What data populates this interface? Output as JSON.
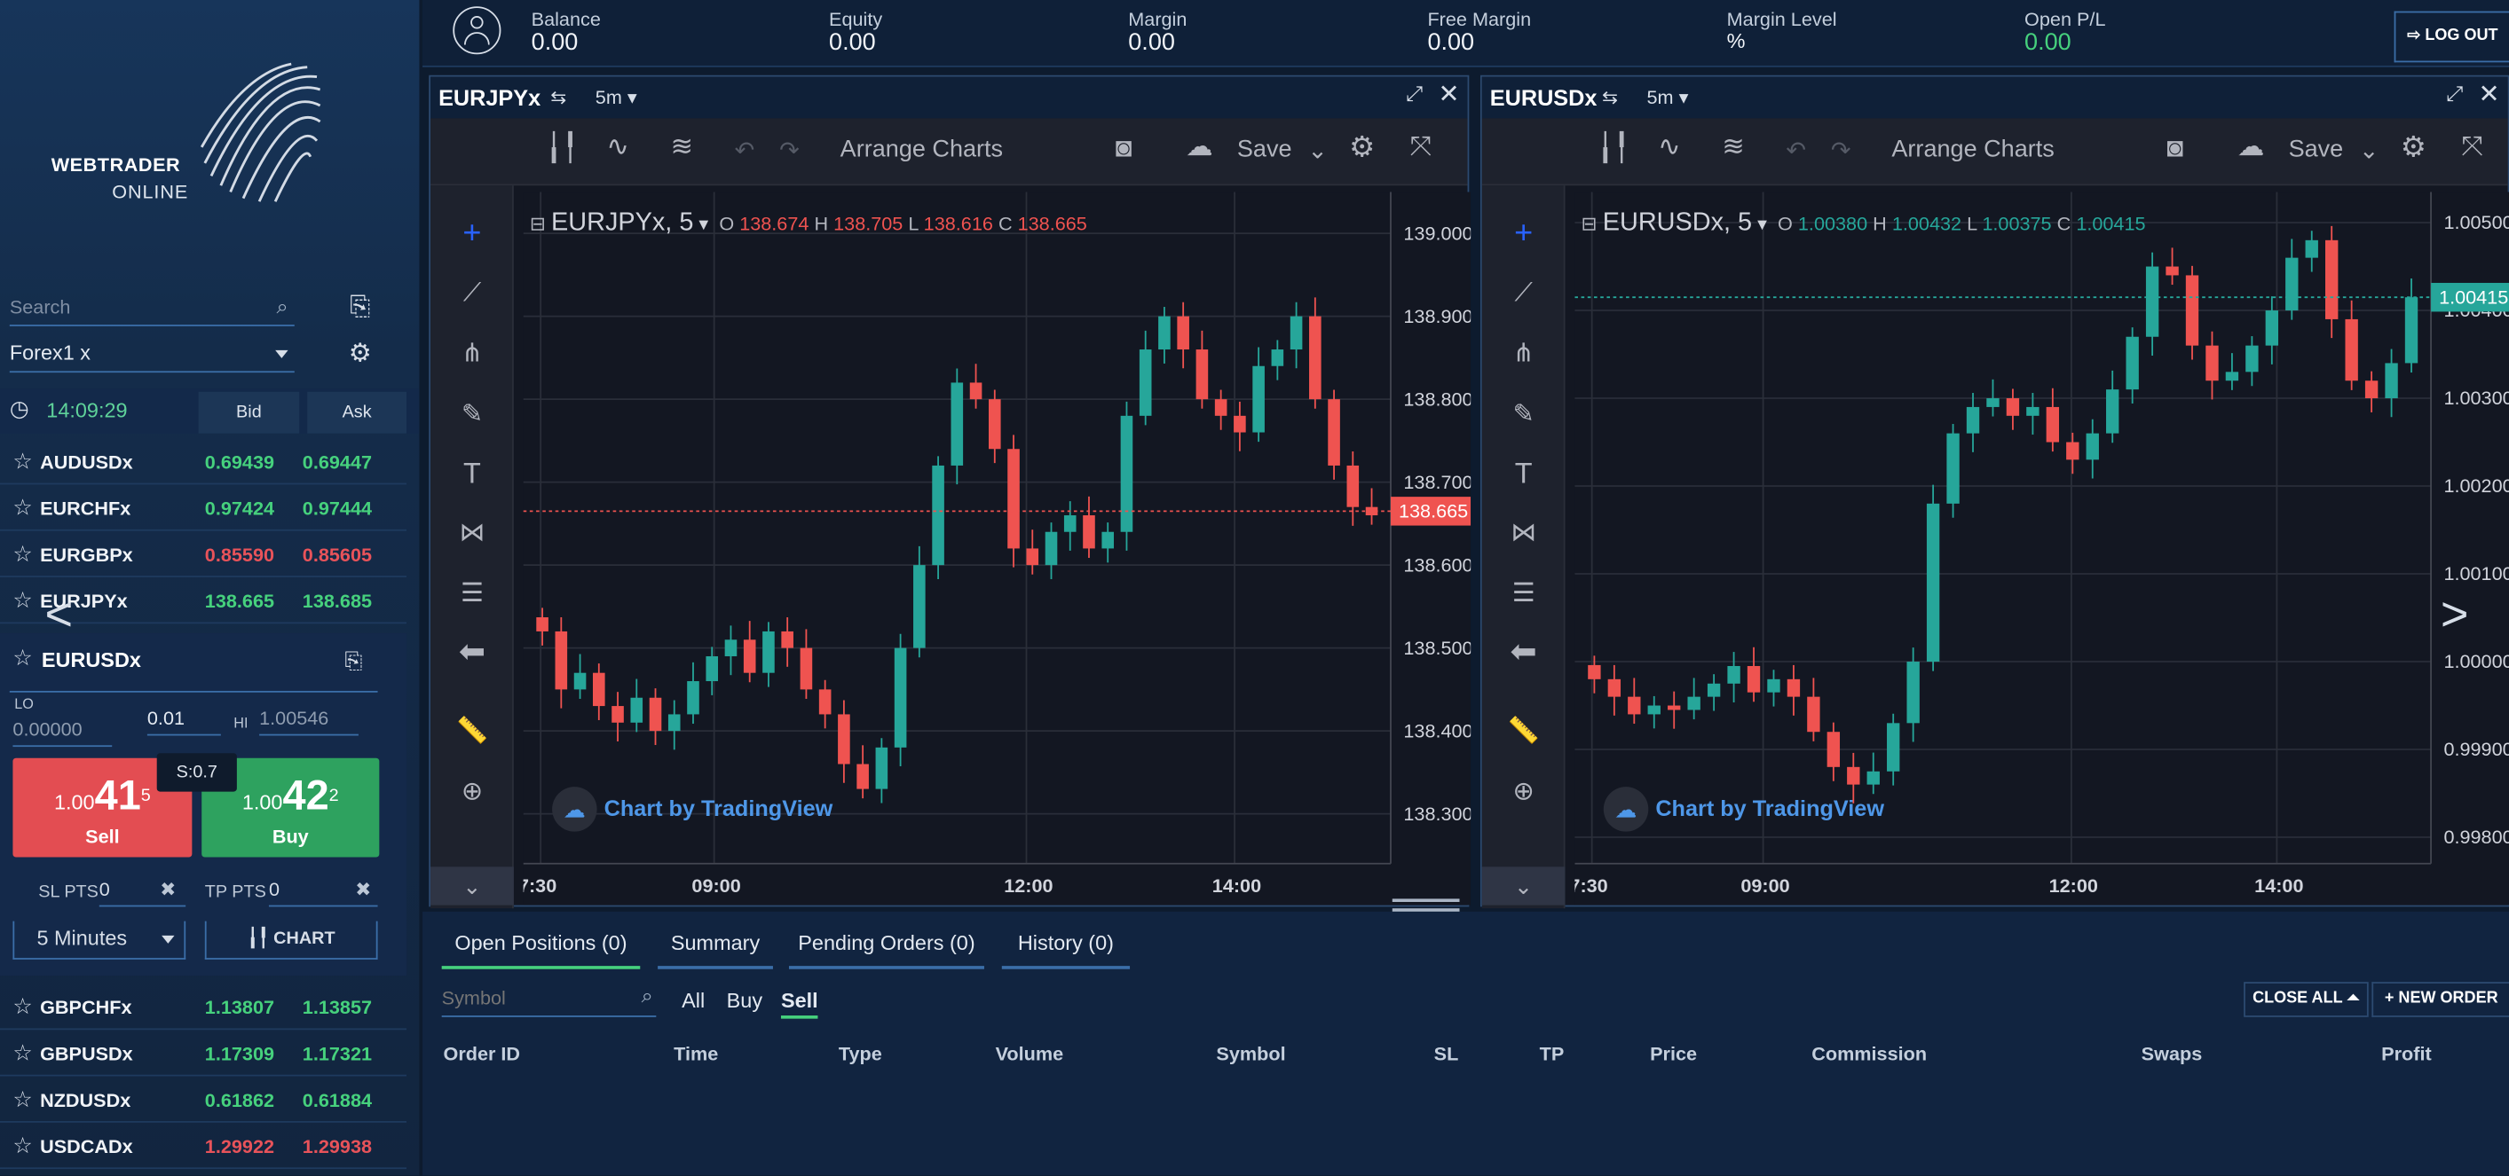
{
  "app": {
    "logo_line1": "WEBTRADER",
    "logo_line2": "ONLINE"
  },
  "sidebar": {
    "search_placeholder": "Search",
    "group_select": "Forex1 x",
    "time": "14:09:29",
    "bid_header": "Bid",
    "ask_header": "Ask",
    "rows_top": [
      {
        "symbol": "AUDUSDx",
        "bid": "0.69439",
        "ask": "0.69447",
        "dir": "up"
      },
      {
        "symbol": "EURCHFx",
        "bid": "0.97424",
        "ask": "0.97444",
        "dir": "up"
      },
      {
        "symbol": "EURGBPx",
        "bid": "0.85590",
        "ask": "0.85605",
        "dir": "dn"
      },
      {
        "symbol": "EURJPYx",
        "bid": "138.665",
        "ask": "138.685",
        "dir": "up"
      }
    ],
    "selected": {
      "symbol": "EURUSDx",
      "lo_label": "LO",
      "lo_value": "0.00000",
      "lot": "0.01",
      "hi_label": "HI",
      "hi_value": "1.00546",
      "spread": "S:0.7",
      "sell_prefix": "1.00",
      "sell_big": "41",
      "sell_sup": "5",
      "sell_label": "Sell",
      "buy_prefix": "1.00",
      "buy_big": "42",
      "buy_sup": "2",
      "buy_label": "Buy",
      "sl_label": "SL PTS",
      "sl_value": "0",
      "tp_label": "TP PTS",
      "tp_value": "0",
      "interval": "5 Minutes",
      "chart_label": "CHART"
    },
    "rows_bottom": [
      {
        "symbol": "GBPCHFx",
        "bid": "1.13807",
        "ask": "1.13857",
        "dir": "up"
      },
      {
        "symbol": "GBPUSDx",
        "bid": "1.17309",
        "ask": "1.17321",
        "dir": "up"
      },
      {
        "symbol": "NZDUSDx",
        "bid": "0.61862",
        "ask": "0.61884",
        "dir": "up"
      },
      {
        "symbol": "USDCADx",
        "bid": "1.29922",
        "ask": "1.29938",
        "dir": "dn"
      }
    ]
  },
  "account": {
    "balance_label": "Balance",
    "balance": "0.00",
    "equity_label": "Equity",
    "equity": "0.00",
    "margin_label": "Margin",
    "margin": "0.00",
    "free_margin_label": "Free Margin",
    "free_margin": "0.00",
    "margin_level_label": "Margin Level",
    "margin_level": "%",
    "open_pl_label": "Open P/L",
    "open_pl": "0.00",
    "logout": "LOG OUT"
  },
  "charts": [
    {
      "title": "EURJPYx",
      "tf": "5m",
      "arrange": "Arrange Charts",
      "save": "Save",
      "legend_symbol": "EURJPYx, 5",
      "o": "138.674",
      "h": "138.705",
      "l": "138.616",
      "c": "138.665",
      "price_tag": "138.665",
      "brand": "Chart by TradingView",
      "colors": {
        "up": "#26a69a",
        "down": "#ef5350"
      }
    },
    {
      "title": "EURUSDx",
      "tf": "5m",
      "arrange": "Arrange Charts",
      "save": "Save",
      "legend_symbol": "EURUSDx, 5",
      "o": "1.00380",
      "h": "1.00432",
      "l": "1.00375",
      "c": "1.00415",
      "price_tag": "1.00415",
      "brand": "Chart by TradingView",
      "colors": {
        "up": "#26a69a",
        "down": "#ef5350"
      }
    }
  ],
  "chart_data": [
    {
      "type": "candlestick",
      "title": "EURJPYx, 5",
      "x_ticks": [
        "7:30",
        "09:00",
        "12:00",
        "14:00"
      ],
      "y_ticks": [
        "139.000",
        "138.900",
        "138.800",
        "138.700",
        "138.600",
        "138.500",
        "138.400",
        "138.300"
      ],
      "ylim": [
        138.24,
        139.05
      ],
      "last": 138.665,
      "closes": [
        138.52,
        138.45,
        138.47,
        138.43,
        138.41,
        138.44,
        138.4,
        138.42,
        138.46,
        138.49,
        138.51,
        138.47,
        138.52,
        138.5,
        138.45,
        138.42,
        138.36,
        138.33,
        138.38,
        138.5,
        138.6,
        138.72,
        138.82,
        138.8,
        138.74,
        138.62,
        138.6,
        138.64,
        138.66,
        138.62,
        138.64,
        138.78,
        138.86,
        138.9,
        138.86,
        138.8,
        138.78,
        138.76,
        138.84,
        138.86,
        138.9,
        138.8,
        138.72,
        138.67,
        138.66
      ]
    },
    {
      "type": "candlestick",
      "title": "EURUSDx, 5",
      "x_ticks": [
        "7:30",
        "09:00",
        "12:00",
        "14:00"
      ],
      "y_ticks": [
        "1.00500",
        "1.00400",
        "1.00300",
        "1.00200",
        "1.00100",
        "1.00000",
        "0.99900",
        "0.99800"
      ],
      "ylim": [
        0.9977,
        1.00535
      ],
      "last": 1.00415,
      "closes": [
        0.9998,
        0.9996,
        0.9994,
        0.9995,
        0.99945,
        0.9996,
        0.99975,
        0.99995,
        0.99965,
        0.9998,
        0.9996,
        0.9992,
        0.9988,
        0.9986,
        0.99875,
        0.9993,
        1.0,
        1.0018,
        1.0026,
        1.0029,
        1.003,
        1.0028,
        1.0029,
        1.0025,
        1.0023,
        1.0026,
        1.0031,
        1.0037,
        1.0045,
        1.0044,
        1.0036,
        1.0032,
        1.0033,
        1.0036,
        1.004,
        1.0046,
        1.0048,
        1.0039,
        1.0032,
        1.003,
        1.0034,
        1.00415
      ]
    }
  ],
  "orders": {
    "tabs": [
      "Open Positions (0)",
      "Summary",
      "Pending Orders (0)",
      "History (0)"
    ],
    "symbol_placeholder": "Symbol",
    "filters": [
      "All",
      "Buy",
      "Sell"
    ],
    "close_all": "CLOSE ALL",
    "new_order": "NEW ORDER",
    "columns": [
      "Order ID",
      "Time",
      "Type",
      "Volume",
      "Symbol",
      "SL",
      "TP",
      "Price",
      "Commission",
      "Swaps",
      "Profit"
    ]
  }
}
